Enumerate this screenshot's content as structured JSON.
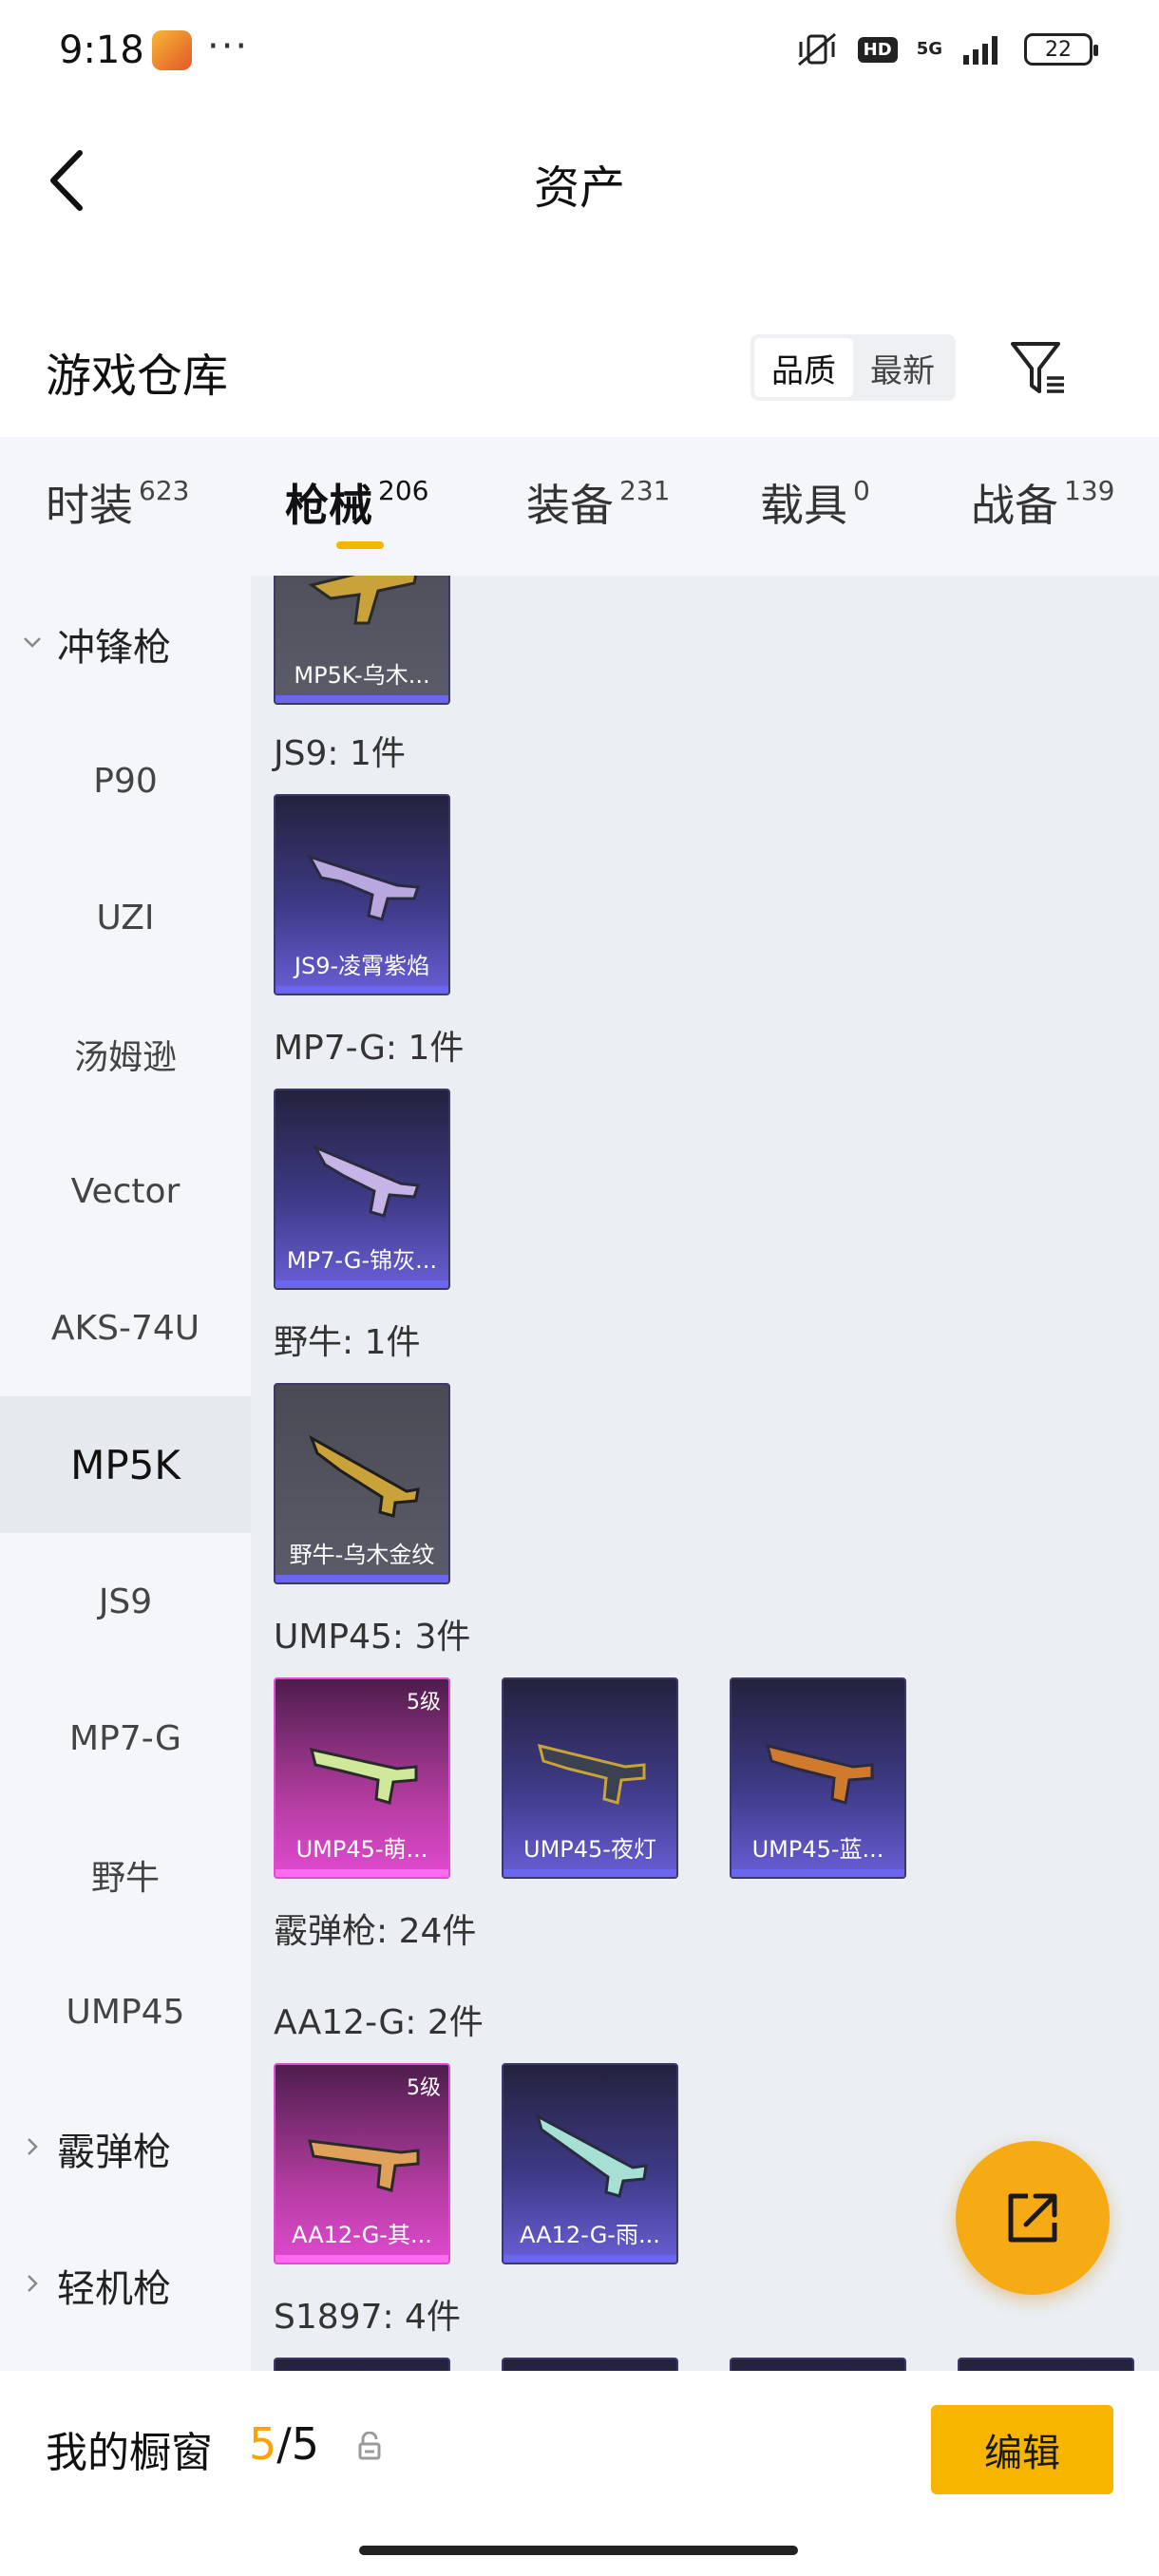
{
  "status_bar": {
    "time": "9:18",
    "more": "···",
    "hd": "HD",
    "network": "5G",
    "battery": "22"
  },
  "nav": {
    "title": "资产"
  },
  "warehouse": {
    "title": "游戏仓库",
    "sort_quality": "品质",
    "sort_newest": "最新"
  },
  "tabs": [
    {
      "label": "时装",
      "count": "623"
    },
    {
      "label": "枪械",
      "count": "206"
    },
    {
      "label": "装备",
      "count": "231"
    },
    {
      "label": "载具",
      "count": "0"
    },
    {
      "label": "战备",
      "count": "139"
    }
  ],
  "sidebar": {
    "group_smg": "冲锋枪",
    "items": [
      "P90",
      "UZI",
      "汤姆逊",
      "Vector",
      "AKS-74U",
      "MP5K",
      "JS9",
      "MP7-G",
      "野牛",
      "UMP45"
    ],
    "group_shotgun": "霰弹枪",
    "group_lmg": "轻机枪"
  },
  "content": {
    "top_card": "MP5K-乌木...",
    "js9_label": "JS9: 1件",
    "js9_card": "JS9-凌霄紫焰",
    "mp7_label": "MP7-G: 1件",
    "mp7_card": "MP7-G-锦灰...",
    "bison_label": "野牛: 1件",
    "bison_card": "野牛-乌木金纹",
    "ump_label": "UMP45: 3件",
    "ump_cards": [
      "UMP45-萌...",
      "UMP45-夜灯",
      "UMP45-蓝..."
    ],
    "ump_level": "5级",
    "shotgun_label": "霰弹枪: 24件",
    "aa12_label": "AA12-G: 2件",
    "aa12_cards": [
      "AA12-G-其...",
      "AA12-G-雨..."
    ],
    "aa12_level": "5级",
    "s1897_label": "S1897: 4件"
  },
  "bottom": {
    "label": "我的橱窗",
    "current": "5",
    "separator": "/",
    "total": "5",
    "edit": "编辑"
  },
  "colors": {
    "accent": "#f7b500",
    "share": "#f6aa14"
  }
}
